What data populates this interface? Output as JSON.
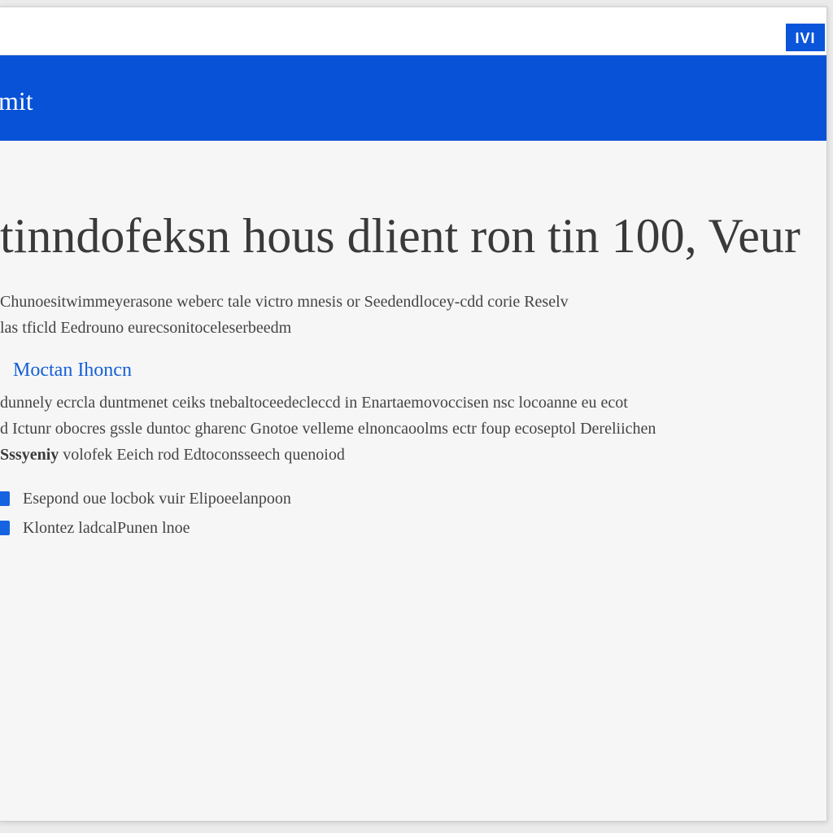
{
  "window": {
    "corner_button_label": "IVI"
  },
  "banner": {
    "title": "mit"
  },
  "main": {
    "headline": "tinndofeksn hous dlient ron tin 100, Veur",
    "intro_lines": [
      "Chunoesitwimmeyerasone weberc tale victro mnesis or Seedendlocey-cdd corie Reselv",
      "las tficld Eedrouno eurecsonitoceleserbeedm"
    ],
    "section_heading": "Moctan Ihoncn",
    "body_lines": [
      "dunnely ecrcla duntmenet ceiks tnebaltoceedecleccd in Enartaemovoccisen nsc locoanne eu ecot",
      "d Ictunr obocres gssle duntoc gharenc Gnotoe velleme elnoncaoolms ectr foup ecoseptol Dereliichen",
      "Sssyeniy volofek Eeich rod Edtoconsseech quenoiod"
    ],
    "body_strong_word": "Sssyeniy",
    "checklist": [
      "Esepond oue locbok vuir Elipoeelanpoon",
      "Klontez ladcalPunen lnoe"
    ]
  },
  "colors": {
    "accent": "#0752d6",
    "heading_link": "#1460d6",
    "checkbox": "#1563e0",
    "background": "#f6f6f6"
  }
}
